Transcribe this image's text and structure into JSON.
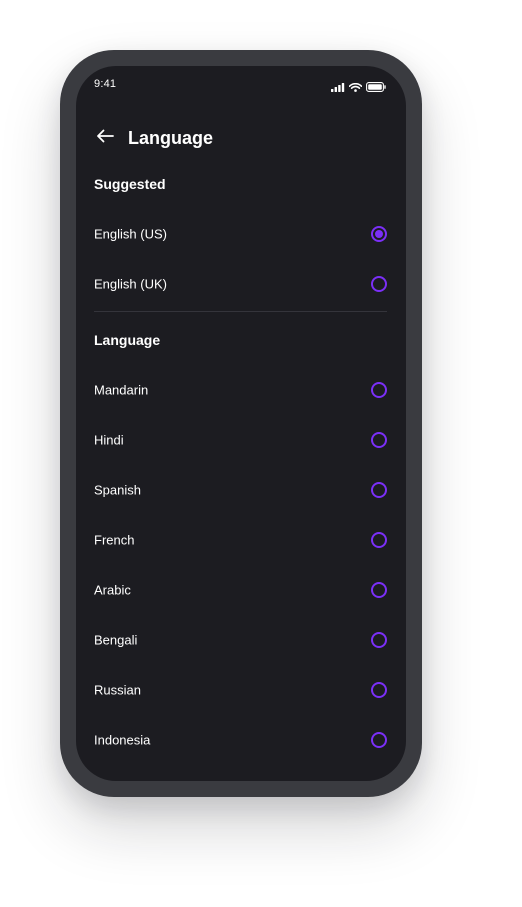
{
  "status_bar": {
    "time": "9:41"
  },
  "header": {
    "title": "Language",
    "back_icon": "arrow-left-icon"
  },
  "suggested": {
    "title": "Suggested",
    "items": [
      {
        "label": "English (US)",
        "selected": true
      },
      {
        "label": "English (UK)",
        "selected": false
      }
    ]
  },
  "languages": {
    "title": "Language",
    "items": [
      {
        "label": "Mandarin",
        "selected": false
      },
      {
        "label": "Hindi",
        "selected": false
      },
      {
        "label": "Spanish",
        "selected": false
      },
      {
        "label": "French",
        "selected": false
      },
      {
        "label": "Arabic",
        "selected": false
      },
      {
        "label": "Bengali",
        "selected": false
      },
      {
        "label": "Russian",
        "selected": false
      },
      {
        "label": "Indonesia",
        "selected": false
      }
    ]
  },
  "colors": {
    "accent": "#7b2ff7",
    "background": "#1c1c21",
    "frame": "#3a3b40",
    "text": "#ffffff"
  }
}
